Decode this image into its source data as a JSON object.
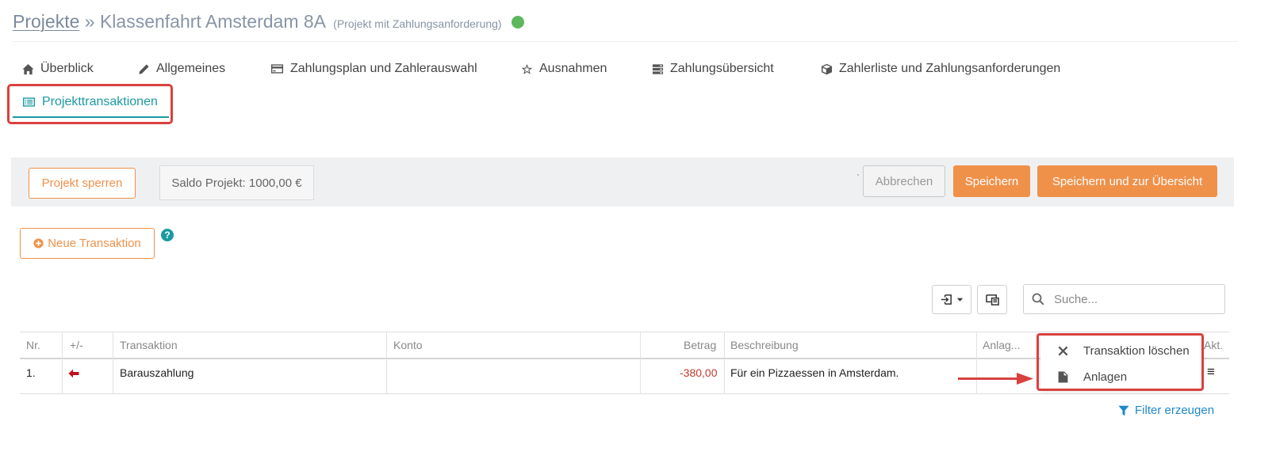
{
  "header": {
    "breadcrumb_link": "Projekte",
    "separator": "»",
    "project_name": "Klassenfahrt Amsterdam 8A",
    "project_type": "(Projekt mit Zahlungsanforderung)",
    "status_color": "#5cb85c"
  },
  "tabs": [
    {
      "label": "Überblick",
      "icon": "home-icon"
    },
    {
      "label": "Allgemeines",
      "icon": "pencil-icon"
    },
    {
      "label": "Zahlungsplan und Zahlerauswahl",
      "icon": "credit-card-icon"
    },
    {
      "label": "Ausnahmen",
      "icon": "star-icon"
    },
    {
      "label": "Zahlungsübersicht",
      "icon": "server-icon"
    },
    {
      "label": "Zahlerliste und Zahlungsanforderungen",
      "icon": "cube-icon"
    },
    {
      "label": "Projekttransaktionen",
      "icon": "list-alt-icon",
      "active": true
    }
  ],
  "toolbar": {
    "lock_label": "Projekt sperren",
    "saldo_label": "Saldo Projekt: 1000,00 €",
    "tick": "`",
    "cancel_label": "Abbrechen",
    "save_label": "Speichern",
    "save_overview_label": "Speichern und zur Übersicht"
  },
  "actions": {
    "new_transaction_label": "Neue Transaktion",
    "help_glyph": "?"
  },
  "search": {
    "placeholder": "Suche..."
  },
  "table": {
    "columns": [
      "Nr.",
      "+/-",
      "Transaktion",
      "Konto",
      "Betrag",
      "Beschreibung",
      "Anlag...",
      "Akt."
    ],
    "rows": [
      {
        "nr": "1.",
        "direction": "out",
        "transaktion": "Barauszahlung",
        "konto": "",
        "betrag": "-380,00",
        "beschreibung": "Für ein Pizzaessen in Amsterdam.",
        "menu_glyph": "≡"
      }
    ]
  },
  "dropdown": {
    "delete_label": "Transaktion löschen",
    "attachments_label": "Anlagen"
  },
  "filter": {
    "label": "Filter erzeugen"
  },
  "colors": {
    "accent_teal": "#1b9aa0",
    "orange": "#f0914a",
    "highlight_red": "#d9413e",
    "negative": "#c0392b",
    "link_blue": "#1e88c8"
  }
}
